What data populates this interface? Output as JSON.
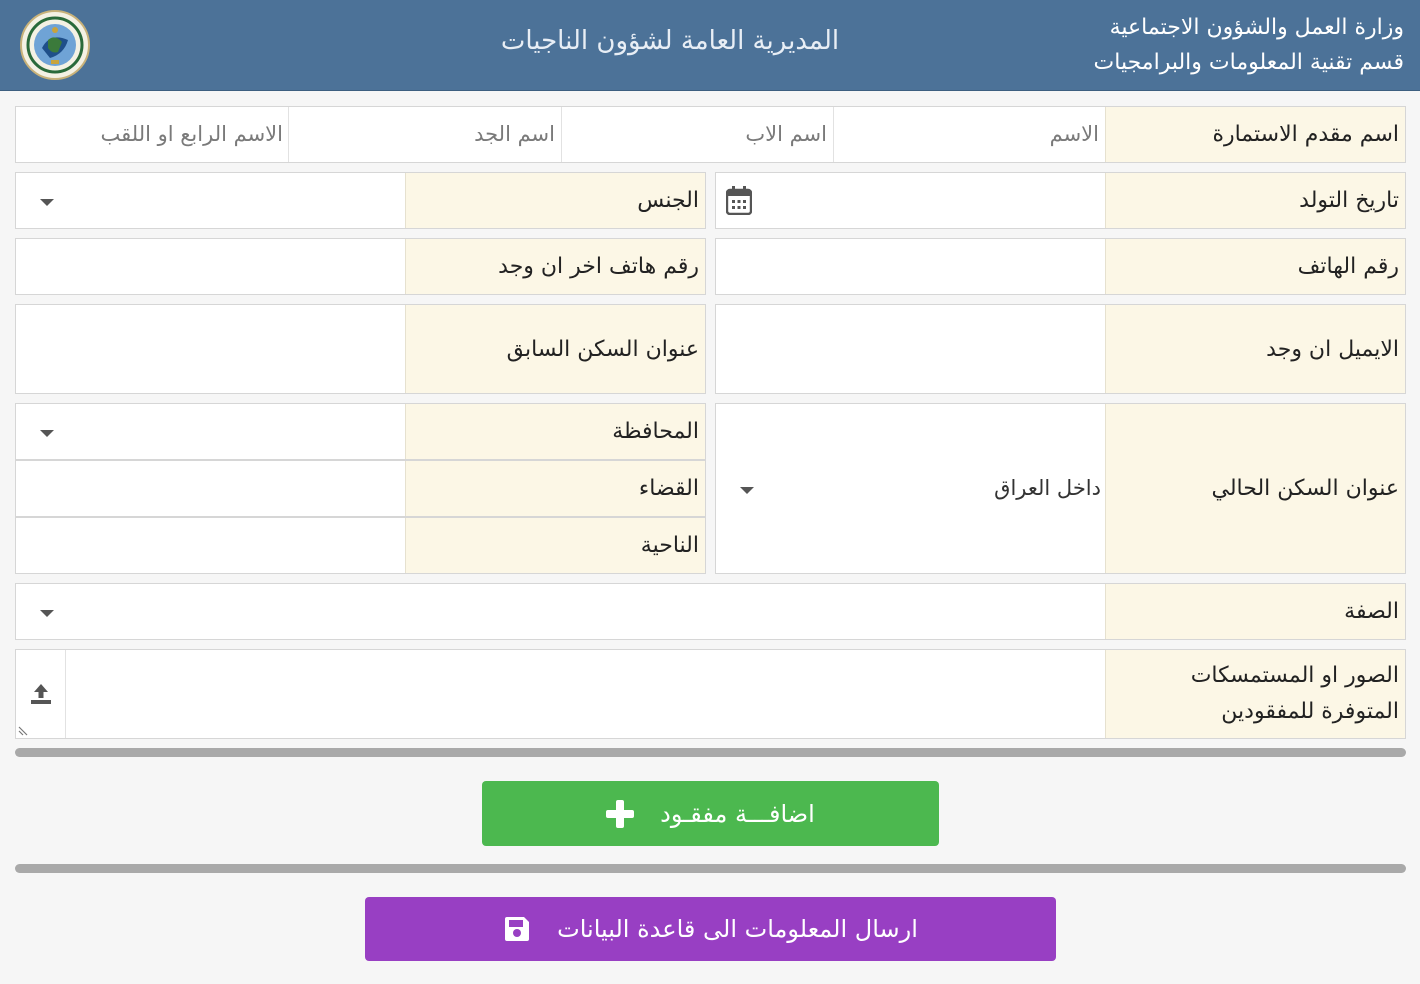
{
  "header": {
    "ministry_line1": "وزارة العمل والشؤون الاجتماعية",
    "ministry_line2": "قسم تقنية المعلومات والبرامجيات",
    "title": "المديرية العامة لشؤون الناجيات",
    "logo_icon": "ministry-seal-logo"
  },
  "form": {
    "applicant_name": {
      "label": "اسم مقدم الاستمارة",
      "first_name_placeholder": "الاسم",
      "father_name_placeholder": "اسم الاب",
      "grandfather_name_placeholder": "اسم الجد",
      "fourth_name_placeholder": "الاسم الرابع او اللقب"
    },
    "birth_date": {
      "label": "تاريخ التولد",
      "value": "",
      "icon": "calendar-icon"
    },
    "gender": {
      "label": "الجنس",
      "value": ""
    },
    "phone": {
      "label": "رقم الهاتف",
      "value": ""
    },
    "other_phone": {
      "label": "رقم هاتف اخر ان وجد",
      "value": ""
    },
    "email": {
      "label": "الايميل ان وجد",
      "value": ""
    },
    "previous_address": {
      "label": "عنوان السكن السابق",
      "value": ""
    },
    "current_address": {
      "label": "عنوان السكن الحالي",
      "value": "داخل العراق"
    },
    "governorate": {
      "label": "المحافظة",
      "value": ""
    },
    "district": {
      "label": "القضاء",
      "value": ""
    },
    "subdistrict": {
      "label": "الناحية",
      "value": ""
    },
    "relation": {
      "label": "الصفة",
      "value": ""
    },
    "attachments": {
      "label_line1": "الصور او المستمسكات",
      "label_line2": "المتوفرة للمفقودين",
      "icon": "upload-icon"
    }
  },
  "buttons": {
    "add_missing": "اضافـــة مفقـود",
    "submit": "ارسال المعلومات الى قاعدة البيانات"
  },
  "colors": {
    "header_bg": "#4c7298",
    "label_bg": "#fcf7e6",
    "add_button": "#4cb84f",
    "submit_button": "#983fc3",
    "divider": "#a9a9a9"
  }
}
